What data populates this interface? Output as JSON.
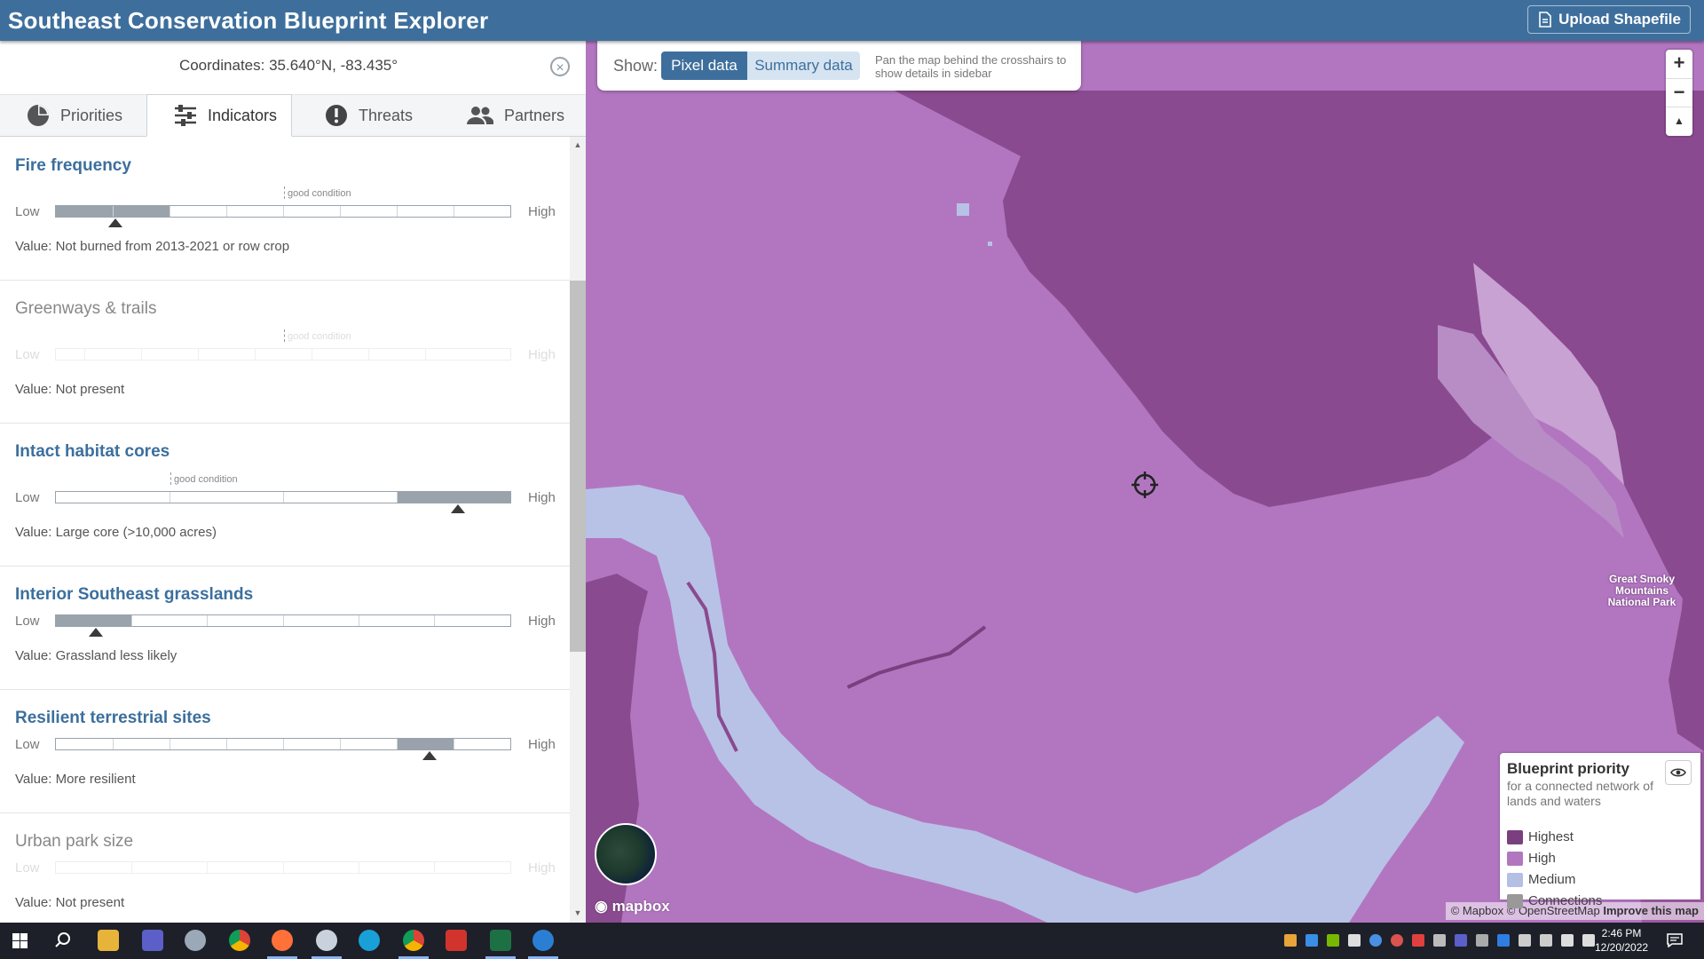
{
  "header": {
    "title": "Southeast  Conservation Blueprint Explorer",
    "upload_label": "Upload Shapefile"
  },
  "sidebar": {
    "coordinates": "Coordinates: 35.640°N, -83.435°",
    "close_symbol": "×",
    "tabs": [
      {
        "label": "Priorities",
        "icon": "pie-chart-icon",
        "active": false
      },
      {
        "label": "Indicators",
        "icon": "sliders-icon",
        "active": true
      },
      {
        "label": "Threats",
        "icon": "exclamation-icon",
        "active": false
      },
      {
        "label": "Partners",
        "icon": "users-icon",
        "active": false
      }
    ],
    "low_label": "Low",
    "high_label": "High",
    "good_condition_label": "good condition",
    "indicators": [
      {
        "title": "Fire frequency",
        "value": "Value: Not burned from 2013-2021 or row crop",
        "present": true,
        "bins": 8,
        "selected_bin": 2,
        "good_from_bin": 4
      },
      {
        "title": "Greenways & trails",
        "value": "Value: Not present",
        "present": false,
        "bins": 8,
        "selected_bin": null,
        "good_from_bin": 4
      },
      {
        "title": "Intact habitat cores",
        "value": "Value: Large core (>10,000 acres)",
        "present": true,
        "bins": 4,
        "selected_bin": 4,
        "good_from_bin": 2
      },
      {
        "title": "Interior Southeast grasslands",
        "value": "Value: Grassland less likely",
        "present": true,
        "bins": 6,
        "selected_bin": 1,
        "good_from_bin": null
      },
      {
        "title": "Resilient terrestrial sites",
        "value": "Value: More resilient",
        "present": true,
        "bins": 8,
        "selected_bin": 7,
        "good_from_bin": null
      },
      {
        "title": "Urban park size",
        "value": "Value: Not present",
        "present": false,
        "bins": 6,
        "selected_bin": null,
        "good_from_bin": null
      }
    ]
  },
  "map": {
    "show_label": "Show:",
    "pixel_data_label": "Pixel data",
    "summary_data_label": "Summary data",
    "hint": "Pan the map behind the crosshairs to show details in sidebar",
    "zoom_in": "+",
    "zoom_out": "−",
    "reset_north": "▲",
    "park_label": "Great Smoky Mountains National Park",
    "mapbox_label": "mapbox",
    "attribution_prefix": "© Mapbox © OpenStreetMap",
    "attribution_link": "Improve this map",
    "legend": {
      "title": "Blueprint priority",
      "subtitle": "for a connected network of lands and waters",
      "items": [
        {
          "label": "Highest",
          "color": "#7b3f80"
        },
        {
          "label": "High",
          "color": "#b276c0"
        },
        {
          "label": "Medium",
          "color": "#b3bfe3"
        },
        {
          "label": "Connections",
          "color": "#999999"
        }
      ]
    },
    "colors": {
      "highest": "#8a4a8f",
      "high": "#b276c0",
      "medium": "#b8c2e6"
    }
  },
  "taskbar": {
    "time": "2:46 PM",
    "date": "12/20/2022",
    "apps": [
      "windows-start-icon",
      "search-icon",
      "file-explorer-icon",
      "teams-icon",
      "app-icon",
      "chrome-icon",
      "firefox-icon",
      "app-icon",
      "edge-icon",
      "chrome-icon",
      "acrobat-icon",
      "excel-icon",
      "app-icon"
    ]
  }
}
